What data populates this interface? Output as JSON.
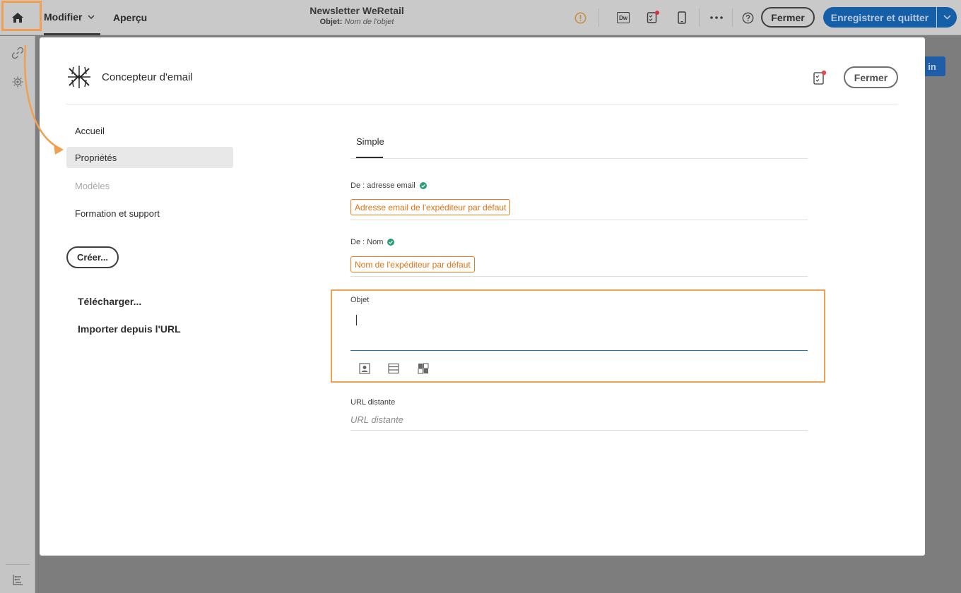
{
  "topbar": {
    "tabs": [
      {
        "label": "Modifier"
      },
      {
        "label": "Aperçu"
      }
    ],
    "title": "Newsletter WeRetail",
    "subject_label": "Objet:",
    "subject_value": "Nom de l'objet",
    "dw_label": "Dw",
    "close_label": "Fermer",
    "save_label": "Enregistrer et quitter"
  },
  "behind": {
    "button_label": "in"
  },
  "modal": {
    "title": "Concepteur d'email",
    "close_label": "Fermer",
    "nav": [
      {
        "label": "Accueil",
        "state": "normal"
      },
      {
        "label": "Propriétés",
        "state": "selected"
      },
      {
        "label": "Modèles",
        "state": "disabled"
      },
      {
        "label": "Formation et support",
        "state": "normal"
      }
    ],
    "create_label": "Créer...",
    "upload_label": "Télécharger...",
    "import_label": "Importer depuis l'URL",
    "tabs": [
      {
        "label": "Simple",
        "active": true
      }
    ],
    "fields": {
      "from_email": {
        "label": "De : adresse email",
        "value": "Adresse email de l'expéditeur par défaut"
      },
      "from_name": {
        "label": "De : Nom",
        "value": "Nom de l'expéditeur par défaut"
      },
      "subject": {
        "label": "Objet",
        "value": ""
      },
      "remote_url": {
        "label": "URL distante",
        "placeholder": "URL distante"
      }
    }
  },
  "colors": {
    "accent_orange": "#f0a050",
    "chip_orange": "#e07316",
    "primary_blue": "#145fa8",
    "valid_green": "#2d9d78",
    "notify_red": "#e34850"
  }
}
